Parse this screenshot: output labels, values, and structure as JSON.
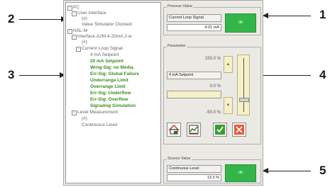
{
  "callouts": {
    "c1": "1",
    "c2": "2",
    "c3": "3",
    "c4": "4",
    "c5": "5"
  },
  "tree": {
    "pc": "PC",
    "user_interface": "User Interface",
    "hash1": "(#)",
    "value_simulator_clocked": "Value Simulator Clocked",
    "nsl_m": "NSL-M",
    "interface": "Interface A2M 4-20mA 2-w",
    "hash2": "(#)",
    "current_loop_signal": "Current Loop Signal",
    "items": [
      "4 mA Setpoint",
      "20 mA Setpoint",
      "Wrng-Sig: no Media",
      "Err-Sig: Global Failure",
      "Underrange Limit",
      "Overrange Limit",
      "Err-Sig: Underflow",
      "Err-Sig: Overflow",
      "Signaling Simulation"
    ],
    "level_measurement": "Level Measurement",
    "hash3": "(#)",
    "continuous_level": "Continuous Level"
  },
  "process_value": {
    "title": "Process Value",
    "signal_name": "Current Loop Signal",
    "value": "4.01 mA",
    "ok": "ok"
  },
  "parameter": {
    "title": "Parameter",
    "max": "150.0 %",
    "setpoint_name": "4 mA Setpoint",
    "value": "0.0 %",
    "min": "-50.0 %",
    "slider_fraction": 0.22
  },
  "source_value": {
    "title": "Source Value",
    "name": "Continuous Level",
    "value": "13.3 %",
    "ok": "ok"
  },
  "colors": {
    "ok": "#33b54a",
    "tree_green": "#3c8c1e",
    "yellow": "#f5f0c8"
  }
}
